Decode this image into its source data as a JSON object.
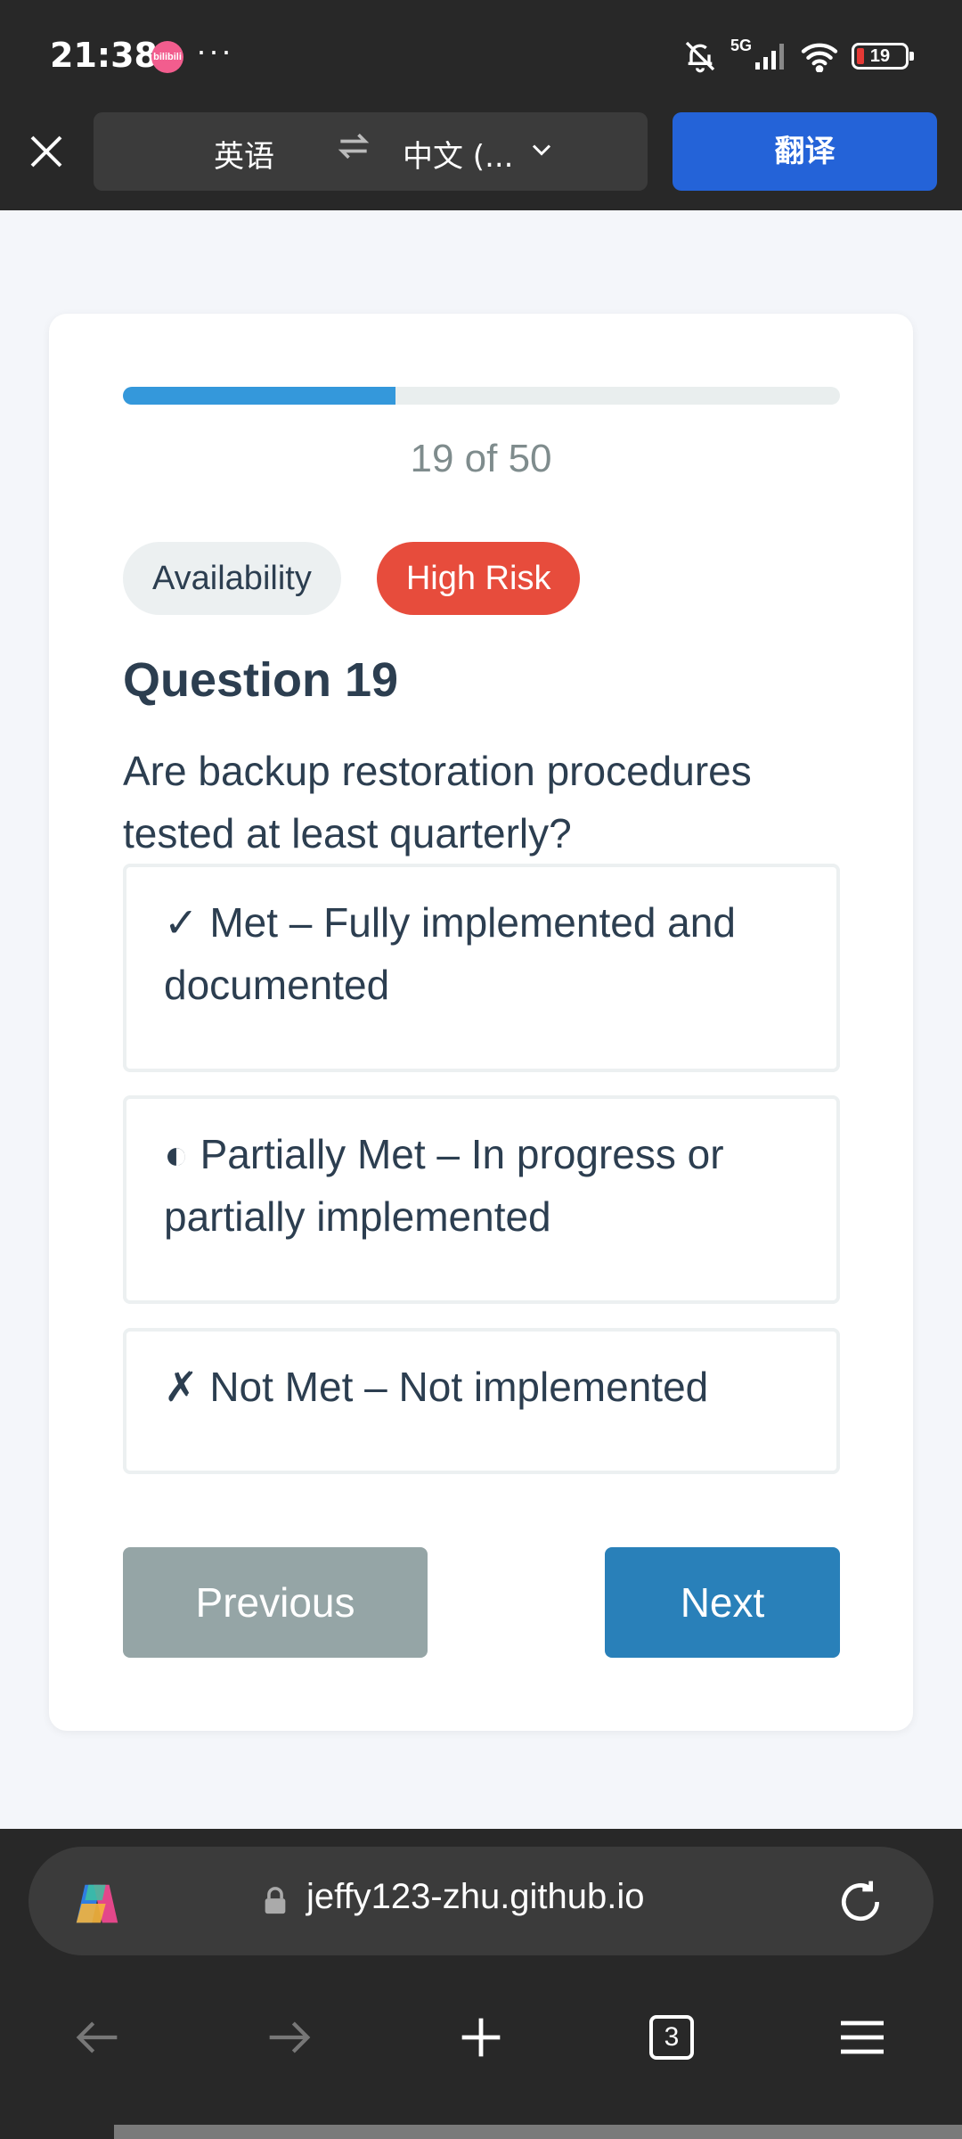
{
  "status_bar": {
    "time": "21:38",
    "app_badge": "bilibili",
    "dots": "···",
    "network": "5G",
    "battery": "19"
  },
  "translate_bar": {
    "source_lang": "英语",
    "target_lang": "中文 (...",
    "translate_label": "翻译"
  },
  "quiz": {
    "progress_text": "19 of 50",
    "progress_fraction": 0.38,
    "category_tag": "Availability",
    "risk_tag": "High Risk",
    "question_title": "Question 19",
    "question_text": "Are backup restoration procedures tested at least quarterly?",
    "options": [
      {
        "label": "✓ Met – Fully implemented and documented"
      },
      {
        "label": "◐ Partially Met – In progress or partially implemented"
      },
      {
        "label": "✗ Not Met – Not implemented"
      }
    ],
    "prev_label": "Previous",
    "next_label": "Next"
  },
  "browser": {
    "url": "jeffy123-zhu.github.io",
    "tab_count": "3"
  },
  "colors": {
    "accent_blue": "#3498db",
    "next_button": "#2980b9",
    "prev_button": "#95a5a6",
    "risk_red": "#e74c3c",
    "translate_button": "#2463d8"
  }
}
